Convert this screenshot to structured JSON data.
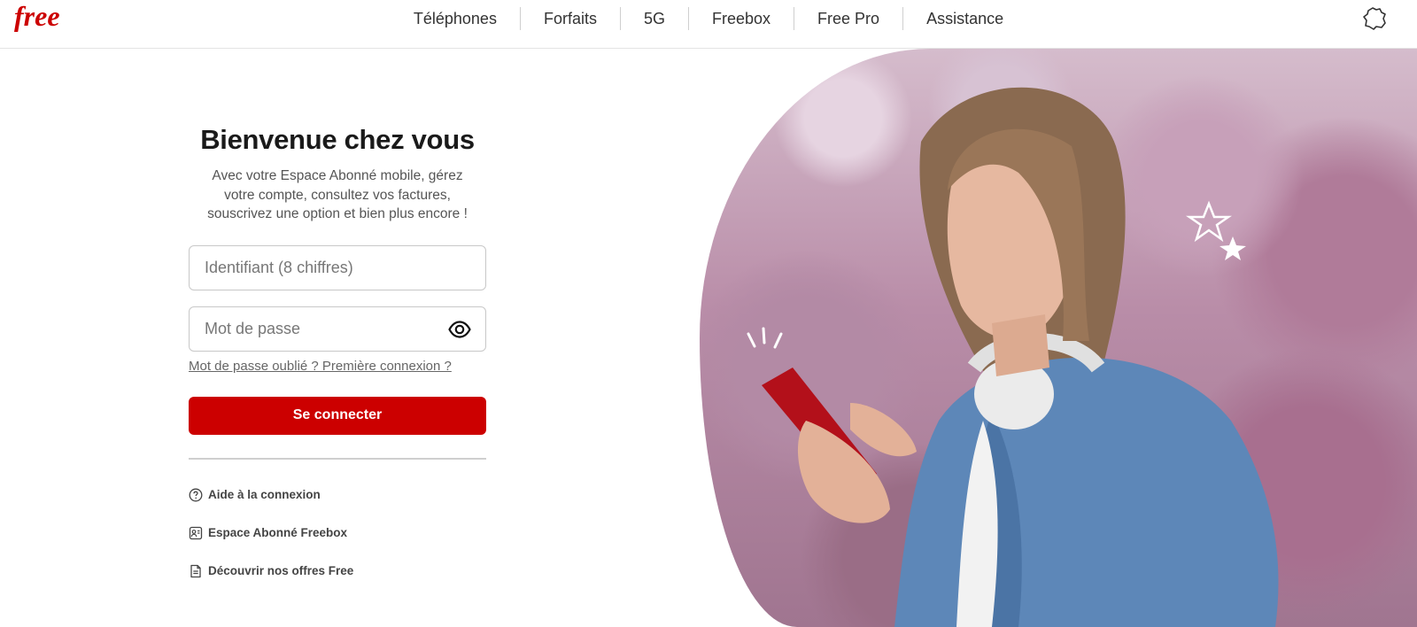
{
  "header": {
    "logo_text": "free",
    "nav": [
      "Téléphones",
      "Forfaits",
      "5G",
      "Freebox",
      "Free Pro",
      "Assistance"
    ],
    "region_icon": "france-map-icon"
  },
  "login": {
    "title": "Bienvenue chez vous",
    "subtitle_lines": [
      "Avec votre Espace Abonné mobile, gérez",
      "votre compte, consultez vos factures,",
      "souscrivez une option et bien plus encore !"
    ],
    "username_placeholder": "Identifiant (8 chiffres)",
    "password_placeholder": "Mot de passe",
    "forgot_link": "Mot de passe oublié ? Première connexion ?",
    "submit_label": "Se connecter"
  },
  "links": [
    {
      "icon": "help-circle-icon",
      "label": "Aide à la connexion"
    },
    {
      "icon": "subscriber-card-icon",
      "label": "Espace Abonné Freebox"
    },
    {
      "icon": "document-icon",
      "label": "Découvrir nos offres Free"
    }
  ],
  "colors": {
    "brand_red": "#cc0000"
  }
}
